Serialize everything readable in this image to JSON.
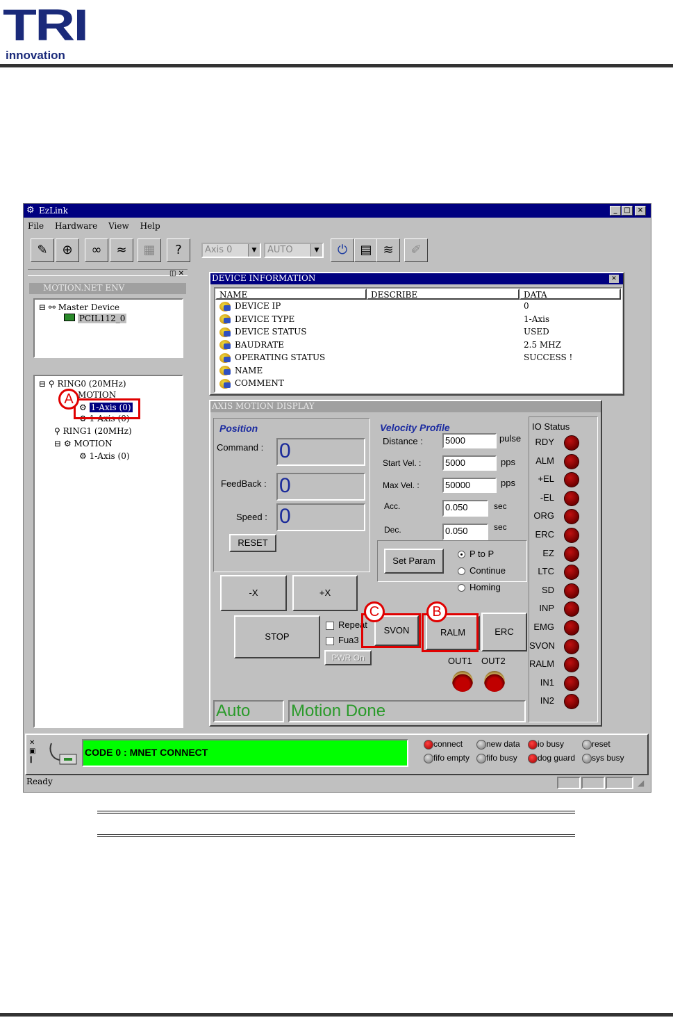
{
  "logo": {
    "brand": "TRI",
    "tagline": "innovation"
  },
  "window": {
    "title": "EzLink",
    "buttons": [
      "_",
      "□",
      "×"
    ]
  },
  "menu": [
    "File",
    "Hardware",
    "View",
    "Help"
  ],
  "toolbar": {
    "axis_select": "Axis 0",
    "mode_select": "AUTO"
  },
  "left_panel": {
    "section_title": "MOTION.NET ENV",
    "env_tree": {
      "root": "Master Device",
      "child": "PCIL112_0"
    },
    "ring_tree": [
      {
        "label": "RING0 (20MHz)",
        "level": 0
      },
      {
        "label": "MOTION",
        "level": 1
      },
      {
        "label": "1-Axis (0)",
        "level": 2,
        "selected": true
      },
      {
        "label": "1-Axis (0)",
        "level": 2
      },
      {
        "label": "RING1 (20MHz)",
        "level": 0
      },
      {
        "label": "MOTION",
        "level": 1
      },
      {
        "label": "1-Axis (0)",
        "level": 2
      }
    ]
  },
  "device_info": {
    "title": "DEVICE INFORMATION",
    "columns": [
      "NAME",
      "DESCRIBE",
      "DATA"
    ],
    "rows": [
      {
        "name": "DEVICE IP",
        "describe": "",
        "data": "0"
      },
      {
        "name": "DEVICE TYPE",
        "describe": "",
        "data": "1-Axis"
      },
      {
        "name": "DEVICE STATUS",
        "describe": "",
        "data": "USED"
      },
      {
        "name": "BAUDRATE",
        "describe": "",
        "data": "2.5 MHZ"
      },
      {
        "name": "OPERATING STATUS",
        "describe": "",
        "data": "SUCCESS !"
      },
      {
        "name": "NAME",
        "describe": "",
        "data": ""
      },
      {
        "name": "COMMENT",
        "describe": "",
        "data": ""
      }
    ]
  },
  "axis_motion": {
    "title": "AXIS MOTION DISPLAY",
    "position": {
      "title": "Position",
      "command_label": "Command :",
      "command_value": "0",
      "feedback_label": "FeedBack :",
      "feedback_value": "0",
      "speed_label": "Speed :",
      "speed_value": "0",
      "reset_label": "RESET"
    },
    "velocity": {
      "title": "Velocity Profile",
      "distance_label": "Distance :",
      "distance_value": "5000",
      "distance_unit": "pulse",
      "start_label": "Start Vel. :",
      "start_value": "5000",
      "start_unit": "pps",
      "max_label": "Max Vel. :",
      "max_value": "50000",
      "max_unit": "pps",
      "acc_label": "Acc.",
      "acc_value": "0.050",
      "acc_unit": "sec",
      "dec_label": "Dec.",
      "dec_value": "0.050",
      "dec_unit": "sec",
      "set_param_label": "Set Param",
      "modes": [
        {
          "label": "P to P",
          "checked": true
        },
        {
          "label": "Continue",
          "checked": false
        },
        {
          "label": "Homing",
          "checked": false
        }
      ]
    },
    "buttons": {
      "minus_x": "-X",
      "plus_x": "+X",
      "stop": "STOP",
      "repeat": "Repeat",
      "fua3": "Fua3",
      "pwr_on": "PWR On",
      "svon": "SVON",
      "ralm": "RALM",
      "erc": "ERC"
    },
    "outputs": [
      "OUT1",
      "OUT2"
    ],
    "io_status": {
      "title": "IO Status",
      "signals": [
        "RDY",
        "ALM",
        "+EL",
        "-EL",
        "ORG",
        "ERC",
        "EZ",
        "LTC",
        "SD",
        "INP",
        "EMG",
        "SVON",
        "RALM",
        "IN1",
        "IN2"
      ]
    },
    "mode_display": "Auto",
    "motion_state": "Motion Done"
  },
  "status_bar": {
    "message": "CODE 0 : MNET CONNECT",
    "indicators": [
      {
        "label": "connect",
        "state": "red"
      },
      {
        "label": "new data",
        "state": "gray"
      },
      {
        "label": "io busy",
        "state": "red"
      },
      {
        "label": "reset",
        "state": "gray"
      },
      {
        "label": "fifo empty",
        "state": "gray"
      },
      {
        "label": "fifo busy",
        "state": "gray"
      },
      {
        "label": "dog guard",
        "state": "red"
      },
      {
        "label": "sys busy",
        "state": "gray"
      }
    ],
    "ready": "Ready"
  },
  "callouts": [
    "A",
    "B",
    "C"
  ],
  "colors": {
    "title_bar": "#000080",
    "status_green": "#00ff00",
    "highlight_red": "#e00000",
    "value_blue": "#1a2a9a"
  }
}
